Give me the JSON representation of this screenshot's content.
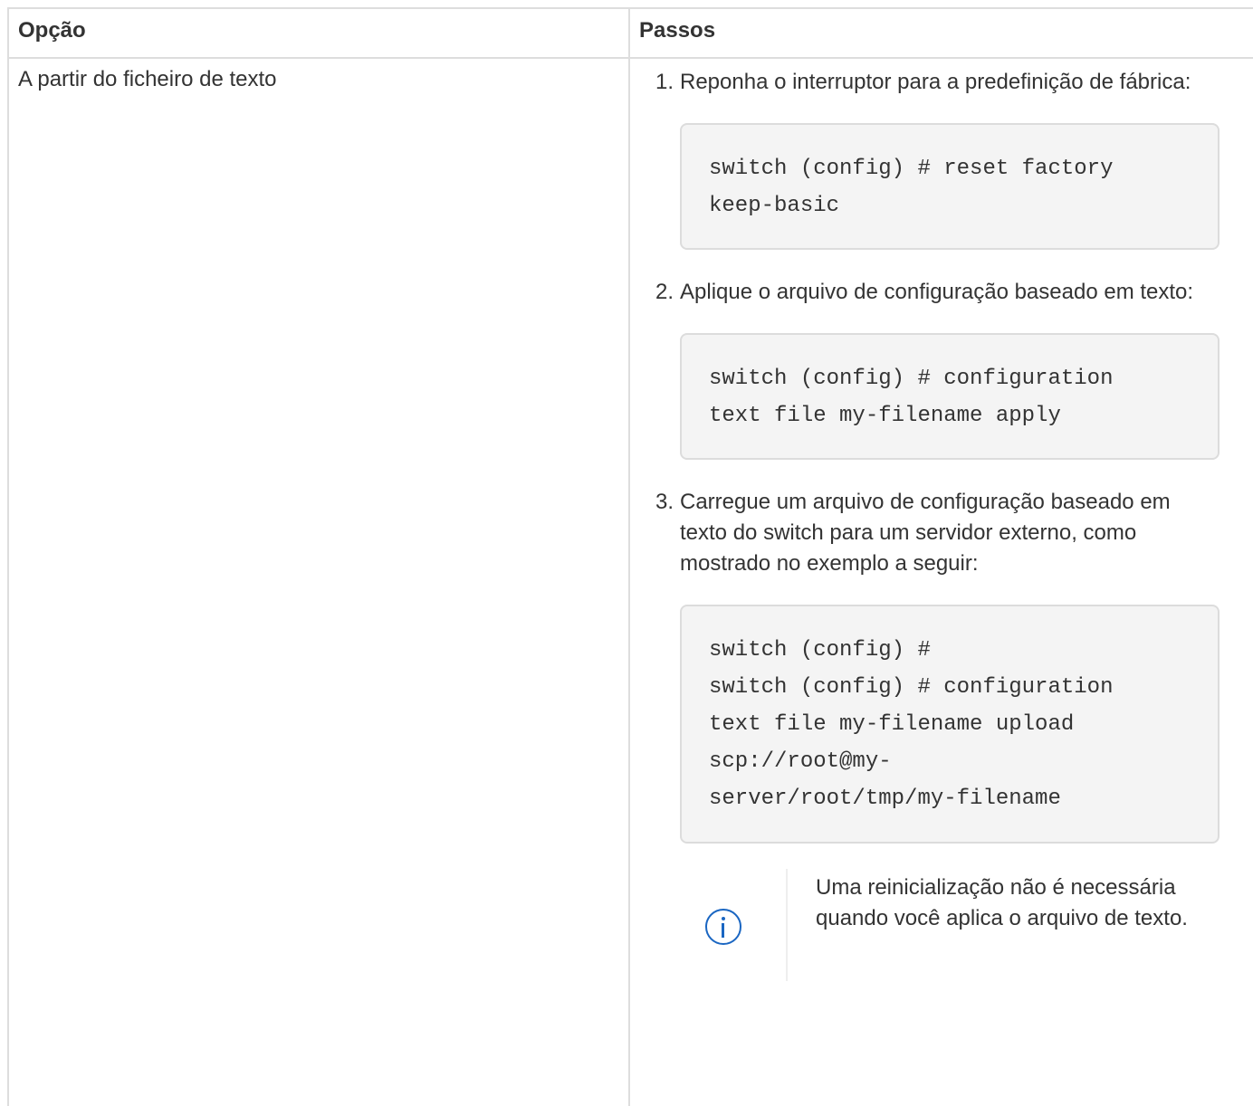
{
  "table": {
    "headers": {
      "option": "Opção",
      "steps": "Passos"
    },
    "row": {
      "option": "A partir do ficheiro de texto",
      "steps": [
        {
          "number": "1.",
          "text": "Reponha o interruptor para a predefinição de fábrica:",
          "code": "switch (config) # reset factory\nkeep-basic"
        },
        {
          "number": "2.",
          "text": "Aplique o arquivo de configuração baseado em texto:",
          "code": "switch (config) # configuration\ntext file my-filename apply"
        },
        {
          "number": "3.",
          "text": "Carregue um arquivo de configuração baseado em texto do switch para um servidor externo, como mostrado no exemplo a seguir:",
          "code": "switch (config) #\nswitch (config) # configuration\ntext file my-filename upload\nscp://root@my-\nserver/root/tmp/my-filename"
        }
      ],
      "note": {
        "icon": "info-icon",
        "text": "Uma reinicialização não é necessária quando você aplica o arquivo de texto."
      }
    }
  },
  "colors": {
    "text": "#333333",
    "border": "#dddddd",
    "code_background": "#f4f4f4",
    "info_icon": "#1a66c2"
  }
}
